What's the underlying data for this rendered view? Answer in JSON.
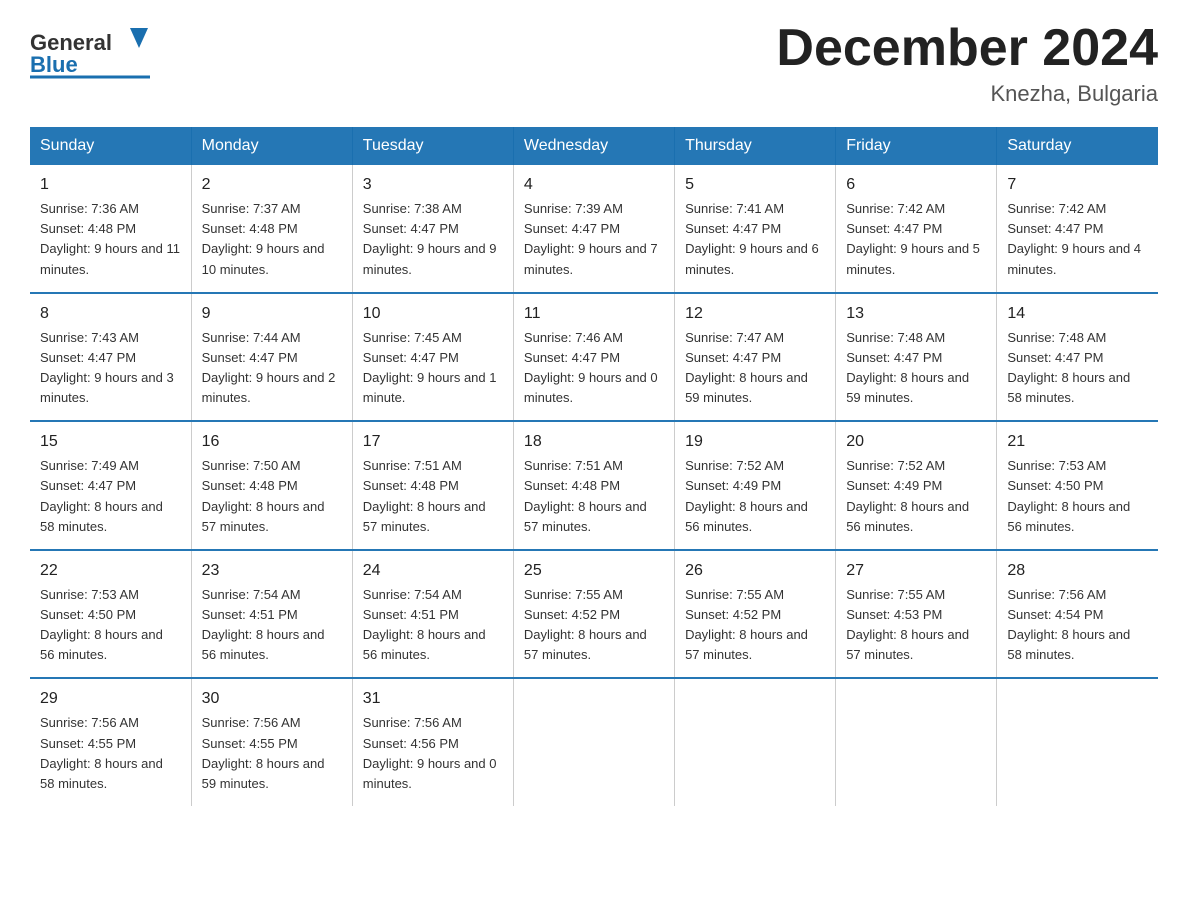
{
  "header": {
    "logo_general": "General",
    "logo_blue": "Blue",
    "title": "December 2024",
    "subtitle": "Knezha, Bulgaria"
  },
  "calendar": {
    "weekdays": [
      "Sunday",
      "Monday",
      "Tuesday",
      "Wednesday",
      "Thursday",
      "Friday",
      "Saturday"
    ],
    "weeks": [
      [
        {
          "day": "1",
          "sunrise": "7:36 AM",
          "sunset": "4:48 PM",
          "daylight": "9 hours and 11 minutes."
        },
        {
          "day": "2",
          "sunrise": "7:37 AM",
          "sunset": "4:48 PM",
          "daylight": "9 hours and 10 minutes."
        },
        {
          "day": "3",
          "sunrise": "7:38 AM",
          "sunset": "4:47 PM",
          "daylight": "9 hours and 9 minutes."
        },
        {
          "day": "4",
          "sunrise": "7:39 AM",
          "sunset": "4:47 PM",
          "daylight": "9 hours and 7 minutes."
        },
        {
          "day": "5",
          "sunrise": "7:41 AM",
          "sunset": "4:47 PM",
          "daylight": "9 hours and 6 minutes."
        },
        {
          "day": "6",
          "sunrise": "7:42 AM",
          "sunset": "4:47 PM",
          "daylight": "9 hours and 5 minutes."
        },
        {
          "day": "7",
          "sunrise": "7:42 AM",
          "sunset": "4:47 PM",
          "daylight": "9 hours and 4 minutes."
        }
      ],
      [
        {
          "day": "8",
          "sunrise": "7:43 AM",
          "sunset": "4:47 PM",
          "daylight": "9 hours and 3 minutes."
        },
        {
          "day": "9",
          "sunrise": "7:44 AM",
          "sunset": "4:47 PM",
          "daylight": "9 hours and 2 minutes."
        },
        {
          "day": "10",
          "sunrise": "7:45 AM",
          "sunset": "4:47 PM",
          "daylight": "9 hours and 1 minute."
        },
        {
          "day": "11",
          "sunrise": "7:46 AM",
          "sunset": "4:47 PM",
          "daylight": "9 hours and 0 minutes."
        },
        {
          "day": "12",
          "sunrise": "7:47 AM",
          "sunset": "4:47 PM",
          "daylight": "8 hours and 59 minutes."
        },
        {
          "day": "13",
          "sunrise": "7:48 AM",
          "sunset": "4:47 PM",
          "daylight": "8 hours and 59 minutes."
        },
        {
          "day": "14",
          "sunrise": "7:48 AM",
          "sunset": "4:47 PM",
          "daylight": "8 hours and 58 minutes."
        }
      ],
      [
        {
          "day": "15",
          "sunrise": "7:49 AM",
          "sunset": "4:47 PM",
          "daylight": "8 hours and 58 minutes."
        },
        {
          "day": "16",
          "sunrise": "7:50 AM",
          "sunset": "4:48 PM",
          "daylight": "8 hours and 57 minutes."
        },
        {
          "day": "17",
          "sunrise": "7:51 AM",
          "sunset": "4:48 PM",
          "daylight": "8 hours and 57 minutes."
        },
        {
          "day": "18",
          "sunrise": "7:51 AM",
          "sunset": "4:48 PM",
          "daylight": "8 hours and 57 minutes."
        },
        {
          "day": "19",
          "sunrise": "7:52 AM",
          "sunset": "4:49 PM",
          "daylight": "8 hours and 56 minutes."
        },
        {
          "day": "20",
          "sunrise": "7:52 AM",
          "sunset": "4:49 PM",
          "daylight": "8 hours and 56 minutes."
        },
        {
          "day": "21",
          "sunrise": "7:53 AM",
          "sunset": "4:50 PM",
          "daylight": "8 hours and 56 minutes."
        }
      ],
      [
        {
          "day": "22",
          "sunrise": "7:53 AM",
          "sunset": "4:50 PM",
          "daylight": "8 hours and 56 minutes."
        },
        {
          "day": "23",
          "sunrise": "7:54 AM",
          "sunset": "4:51 PM",
          "daylight": "8 hours and 56 minutes."
        },
        {
          "day": "24",
          "sunrise": "7:54 AM",
          "sunset": "4:51 PM",
          "daylight": "8 hours and 56 minutes."
        },
        {
          "day": "25",
          "sunrise": "7:55 AM",
          "sunset": "4:52 PM",
          "daylight": "8 hours and 57 minutes."
        },
        {
          "day": "26",
          "sunrise": "7:55 AM",
          "sunset": "4:52 PM",
          "daylight": "8 hours and 57 minutes."
        },
        {
          "day": "27",
          "sunrise": "7:55 AM",
          "sunset": "4:53 PM",
          "daylight": "8 hours and 57 minutes."
        },
        {
          "day": "28",
          "sunrise": "7:56 AM",
          "sunset": "4:54 PM",
          "daylight": "8 hours and 58 minutes."
        }
      ],
      [
        {
          "day": "29",
          "sunrise": "7:56 AM",
          "sunset": "4:55 PM",
          "daylight": "8 hours and 58 minutes."
        },
        {
          "day": "30",
          "sunrise": "7:56 AM",
          "sunset": "4:55 PM",
          "daylight": "8 hours and 59 minutes."
        },
        {
          "day": "31",
          "sunrise": "7:56 AM",
          "sunset": "4:56 PM",
          "daylight": "9 hours and 0 minutes."
        },
        {
          "day": "",
          "sunrise": "",
          "sunset": "",
          "daylight": ""
        },
        {
          "day": "",
          "sunrise": "",
          "sunset": "",
          "daylight": ""
        },
        {
          "day": "",
          "sunrise": "",
          "sunset": "",
          "daylight": ""
        },
        {
          "day": "",
          "sunrise": "",
          "sunset": "",
          "daylight": ""
        }
      ]
    ]
  }
}
